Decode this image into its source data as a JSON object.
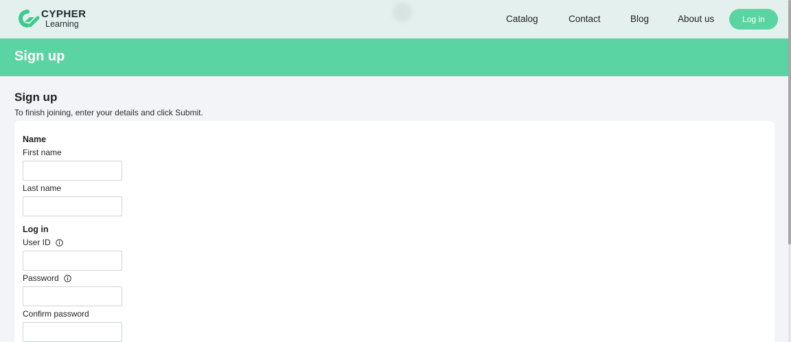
{
  "header": {
    "brand_line1": "CYPHER",
    "brand_line2": "Learning",
    "brand_color": "#3ccb8f",
    "nav": [
      {
        "label": "Catalog"
      },
      {
        "label": "Contact"
      },
      {
        "label": "Blog"
      },
      {
        "label": "About us"
      }
    ],
    "login_label": "Log in",
    "accent": "#5ad4a2"
  },
  "banner": {
    "title": "Sign up"
  },
  "form": {
    "title": "Sign up",
    "description": "To finish joining, enter your details and click Submit.",
    "name_group": {
      "title": "Name",
      "first_name_label": "First name",
      "first_name_value": "",
      "last_name_label": "Last name",
      "last_name_value": ""
    },
    "login_group": {
      "title": "Log in",
      "user_id_label": "User ID",
      "user_id_value": "",
      "password_label": "Password",
      "password_value": "",
      "confirm_password_label": "Confirm password",
      "confirm_password_value": ""
    },
    "info_icon": "info-circle-icon"
  }
}
